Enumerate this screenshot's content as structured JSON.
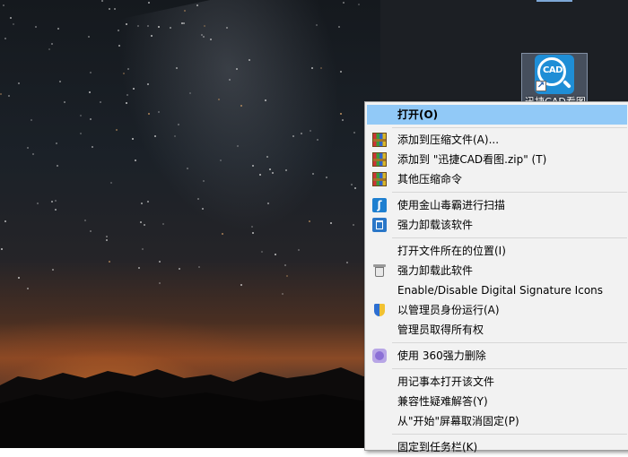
{
  "desktop": {
    "icon": {
      "label": "迅捷CAD看图",
      "logo_text": "CAD",
      "logo_icon": "cad-viewer-icon",
      "overlay_icon": "shortcut-arrow-icon"
    }
  },
  "context_menu": {
    "highlight_color": "#91c9f7",
    "items": [
      {
        "label": "打开(O)",
        "icon": ""
      },
      {
        "label": "添加到压缩文件(A)...",
        "icon": "winrar-icon"
      },
      {
        "label": "添加到 \"迅捷CAD看图.zip\" (T)",
        "icon": "winrar-icon"
      },
      {
        "label": "其他压缩命令",
        "icon": "winrar-icon"
      },
      {
        "label": "使用金山毒霸进行扫描",
        "icon": "kingsoft-antivirus-icon"
      },
      {
        "label": "强力卸载该软件",
        "icon": "uninstall-icon"
      },
      {
        "label": "打开文件所在的位置(I)",
        "icon": ""
      },
      {
        "label": "强力卸载此软件",
        "icon": "trash-icon"
      },
      {
        "label": "Enable/Disable Digital Signature Icons",
        "icon": ""
      },
      {
        "label": "以管理员身份运行(A)",
        "icon": "uac-shield-icon"
      },
      {
        "label": "管理员取得所有权",
        "icon": ""
      },
      {
        "label": "使用 360强力删除",
        "icon": "360-delete-icon"
      },
      {
        "label": "用记事本打开该文件",
        "icon": ""
      },
      {
        "label": "兼容性疑难解答(Y)",
        "icon": ""
      },
      {
        "label": "从\"开始\"屏幕取消固定(P)",
        "icon": ""
      },
      {
        "label": "固定到任务栏(K)",
        "icon": ""
      }
    ]
  }
}
